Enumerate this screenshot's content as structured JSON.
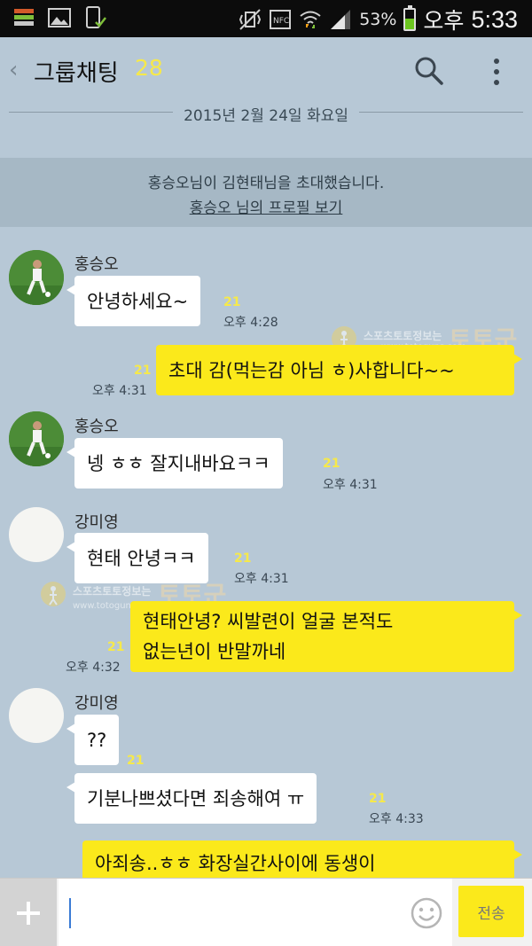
{
  "status": {
    "battery_pct": "53%",
    "ampm": "오후",
    "time": "5:33",
    "battery_level": 0.53,
    "icons": [
      "layers-icon",
      "image-icon",
      "phone-check-icon",
      "vibrate-icon",
      "nfc-icon",
      "wifi-icon",
      "signal-icon"
    ]
  },
  "header": {
    "title": "그룹채팅",
    "count": "28",
    "back_icon": "chevron-left-icon",
    "search_icon": "search-icon",
    "menu_icon": "more-vert-icon"
  },
  "date": "2015년 2월 24일 화요일",
  "notice": {
    "text": "홍승오님이 김현태님을 초대했습니다.",
    "link": "홍승오 님의 프로필 보기"
  },
  "messages": [
    {
      "sender": "홍승오",
      "text": "안녕하세요~",
      "unread": "21",
      "time": "오후 4:28"
    },
    {
      "sender": "",
      "text": "초대 감(먹는감 아님 ㅎ)사합니다~~",
      "unread": "21",
      "time": "오후 4:31"
    },
    {
      "sender": "홍승오",
      "text": "넹 ㅎㅎ 잘지내바요ㅋㅋ",
      "unread": "21",
      "time": "오후 4:31"
    },
    {
      "sender": "강미영",
      "text": "현태 안녕ㅋㅋ",
      "unread": "21",
      "time": "오후 4:31"
    },
    {
      "sender": "",
      "text_line1": "현태안녕? 씨발련이 얼굴 본적도",
      "text_line2": "없는년이 반말까네",
      "unread": "21",
      "time": "오후 4:32"
    },
    {
      "sender": "강미영",
      "text": "??",
      "unread": "21",
      "time": ""
    },
    {
      "sender": "",
      "text": "기분나쁘셨다면 죄송해여 ㅠ",
      "unread": "21",
      "time": "오후 4:33"
    },
    {
      "sender": "",
      "text": "아죄송..ㅎㅎ 화장실간사이에 동생이",
      "unread": "",
      "time": ""
    }
  ],
  "watermark": {
    "line1": "스포츠토토정보는",
    "line2": "토토군",
    "line3": "www.totoguns.com"
  },
  "input": {
    "plus_icon": "plus-icon",
    "emoji_icon": "smiley-icon",
    "send_label": "전송"
  },
  "colors": {
    "background": "#b7c8d6",
    "my_bubble": "#fbe91b",
    "other_bubble": "#ffffff",
    "unread_count": "#f6e94a"
  }
}
